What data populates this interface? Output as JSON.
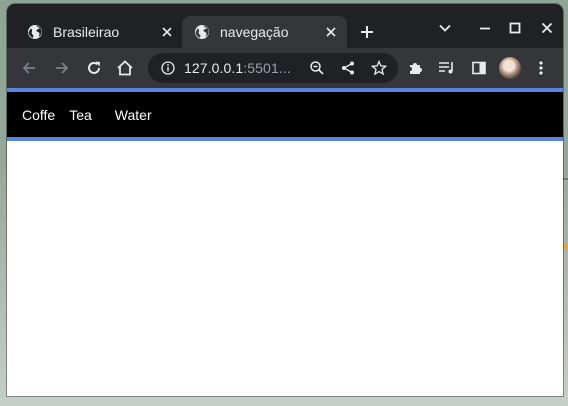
{
  "browser": {
    "tabs": [
      {
        "title": "Brasileirao",
        "icon": "globe-icon",
        "active": false
      },
      {
        "title": "navegação",
        "icon": "globe-icon",
        "active": true
      }
    ],
    "address": {
      "host": "127.0.0.1",
      "rest": ":5501..."
    }
  },
  "page": {
    "nav": {
      "links": [
        "Coffe",
        "Tea",
        "Water"
      ],
      "background": "#000000",
      "border_color": "#5b83e0",
      "text_color": "#ffffff"
    }
  },
  "colors": {
    "titlebar": "#202124",
    "toolbar": "#35363a",
    "text": "#e8eaed"
  }
}
